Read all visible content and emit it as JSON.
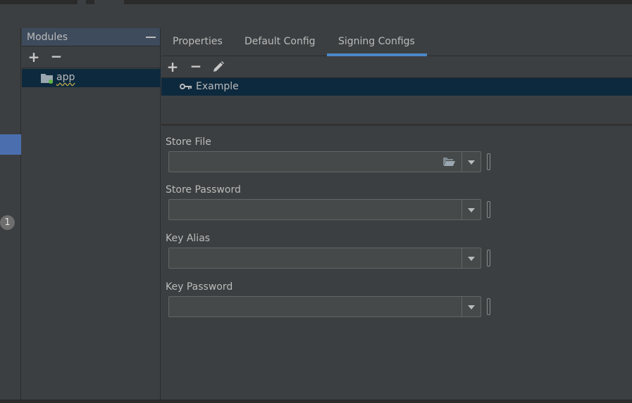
{
  "window": {
    "badge_count": "1"
  },
  "modules_panel": {
    "title": "Modules",
    "add_icon": "plus-icon",
    "remove_icon": "minus-icon",
    "items": [
      {
        "label": "app",
        "icon": "module-folder-icon"
      }
    ]
  },
  "tabs": [
    {
      "label": "Properties",
      "selected": false
    },
    {
      "label": "Default Config",
      "selected": false
    },
    {
      "label": "Signing Configs",
      "selected": true
    }
  ],
  "signing_configs": {
    "toolbar": {
      "add_icon": "plus-icon",
      "remove_icon": "minus-icon",
      "edit_icon": "pencil-icon"
    },
    "items": [
      {
        "label": "Example",
        "icon": "key-icon"
      }
    ]
  },
  "form": {
    "store_file": {
      "label": "Store File",
      "value": ""
    },
    "store_password": {
      "label": "Store Password",
      "value": ""
    },
    "key_alias": {
      "label": "Key Alias",
      "value": ""
    },
    "key_password": {
      "label": "Key Password",
      "value": ""
    }
  },
  "colors": {
    "background": "#3c3f41",
    "selection": "#0d293e",
    "accent": "#4a88c7",
    "nav_selected": "#4b6eaf"
  }
}
